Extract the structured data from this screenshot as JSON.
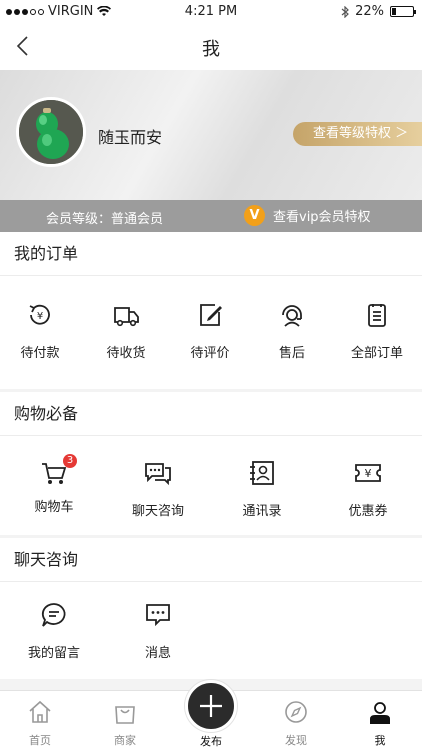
{
  "status": {
    "carrier": "VIRGIN",
    "time": "4:21 PM",
    "battery": "22%",
    "battery_level": 0.22
  },
  "nav": {
    "title": "我"
  },
  "profile": {
    "name": "随玉而安",
    "level_button": "查看等级特权 ＞",
    "member_level": "会员等级：普通会员",
    "vip_badge": "V",
    "vip_link": "查看vip会员特权"
  },
  "orders": {
    "title": "我的订单",
    "items": [
      {
        "label": "待付款"
      },
      {
        "label": "待收货"
      },
      {
        "label": "待评价"
      },
      {
        "label": "售后"
      },
      {
        "label": "全部订单"
      }
    ]
  },
  "shopping": {
    "title": "购物必备",
    "items": [
      {
        "label": "购物车",
        "badge": "3"
      },
      {
        "label": "聊天咨询"
      },
      {
        "label": "通讯录"
      },
      {
        "label": "优惠券"
      }
    ]
  },
  "chat": {
    "title": "聊天咨询",
    "items": [
      {
        "label": "我的留言"
      },
      {
        "label": "消息"
      }
    ]
  },
  "tabs": {
    "home": "首页",
    "shop": "商家",
    "publish": "发布",
    "discover": "发现",
    "me": "我"
  },
  "colors": {
    "gold": "#c5a469",
    "vip": "#f2a01a",
    "badge": "#e53935"
  }
}
